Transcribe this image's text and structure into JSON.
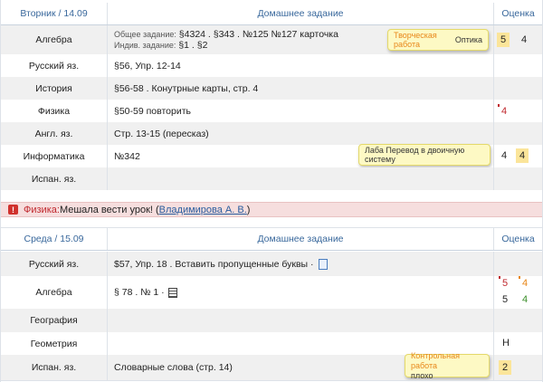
{
  "header_hw": "Домашнее задание",
  "header_grade": "Оценка",
  "days": [
    {
      "date": "Вторник / 14.09",
      "rows": [
        {
          "subject": "Алгебра",
          "hw_general": "Общее задание:",
          "hw_general_value": "§4324 . §343 . №125 №127 карточка",
          "hw_individual": "Индив. задание:",
          "hw_individual_value": "§1 . §2",
          "tip_kind": "Творческая работа",
          "tip_topic": "Оптика",
          "grades": [
            "5",
            "4"
          ]
        },
        {
          "subject": "Русский яз.",
          "hw": "§56, Упр. 12-14"
        },
        {
          "subject": "История",
          "hw": "§56-58 .  Конутрные карты, стр. 4"
        },
        {
          "subject": "Физика",
          "hw": "§50-59 повторить",
          "grades": [
            "4"
          ]
        },
        {
          "subject": "Англ. яз.",
          "hw": "Стр. 13-15 (пересказ)"
        },
        {
          "subject": "Информатика",
          "hw": "№342",
          "tip_text": "Лаба Перевод в двоичную систему",
          "grades": [
            "4",
            "4"
          ]
        },
        {
          "subject": "Испан. яз.",
          "hw": ""
        }
      ]
    },
    {
      "date": "Среда / 15.09",
      "rows": [
        {
          "subject": "Русский яз.",
          "hw": "$57, Упр. 18 .  Вставить пропущенные буквы  ·"
        },
        {
          "subject": "Алгебра",
          "hw": "§ 78 .  № 1  ·",
          "grades": [
            "5",
            "4",
            "5",
            "4"
          ]
        },
        {
          "subject": "География",
          "hw": ""
        },
        {
          "subject": "Геометрия",
          "hw": "",
          "grades": [
            "Н"
          ]
        },
        {
          "subject": "Испан. яз.",
          "hw": "Словарные слова (стр. 14)",
          "tip_text_1": "Контрольная работа",
          "tip_text_2": "плохо",
          "grades": [
            "2"
          ]
        }
      ]
    }
  ],
  "alert": {
    "badge": "!",
    "subject": "Физика:",
    "message": " Мешала вести урок! (",
    "teacher": "Владимирова А. В.",
    "close": ")"
  },
  "colors": {
    "accent": "#39689c",
    "grade_red": "#c0272d",
    "grade_green": "#3b8f2a",
    "grade_orange": "#e8871a",
    "highlight": "#fbe59a"
  }
}
